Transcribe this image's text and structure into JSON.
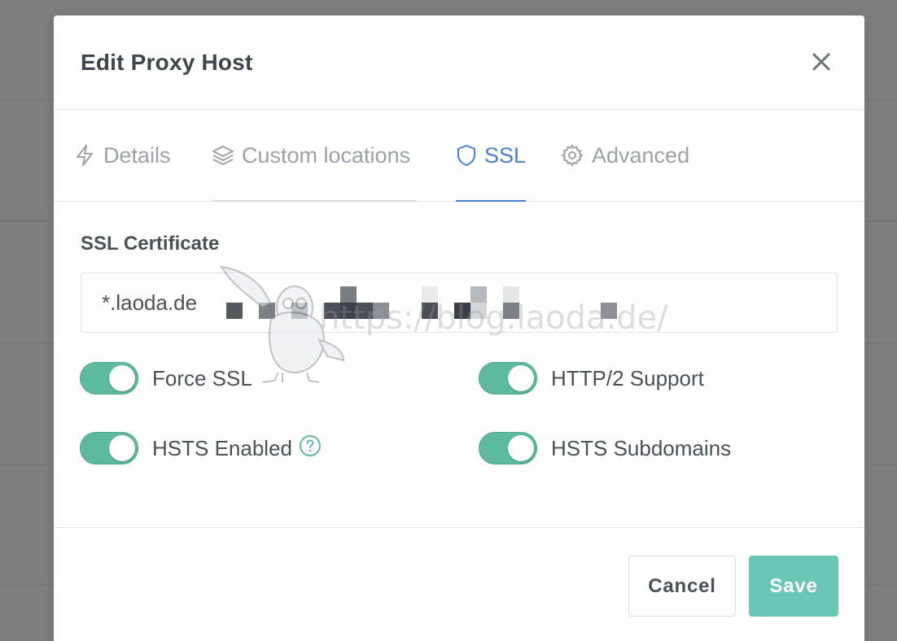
{
  "modal": {
    "title": "Edit Proxy Host"
  },
  "tabs": [
    {
      "label": "Details",
      "icon": "lightning-icon",
      "active": false
    },
    {
      "label": "Custom locations",
      "icon": "layers-icon",
      "active": false
    },
    {
      "label": "SSL",
      "icon": "shield-icon",
      "active": true
    },
    {
      "label": "Advanced",
      "icon": "gear-icon",
      "active": false
    }
  ],
  "ssl": {
    "certificate_label": "SSL Certificate",
    "certificate_value": "*.laoda.de",
    "toggles": {
      "force_ssl": {
        "label": "Force SSL",
        "on": true
      },
      "http2": {
        "label": "HTTP/2 Support",
        "on": true
      },
      "hsts": {
        "label": "HSTS Enabled",
        "on": true
      },
      "hsts_sub": {
        "label": "HSTS Subdomains",
        "on": true
      }
    }
  },
  "footer": {
    "cancel_label": "Cancel",
    "save_label": "Save"
  },
  "watermark": "https://blog.laoda.de/",
  "colors": {
    "accent_blue": "#467fcf",
    "toggle_teal": "#5eba9e",
    "save_teal": "#69c7b3",
    "text_dark": "#495057",
    "text_muted": "#9aa0ac"
  }
}
